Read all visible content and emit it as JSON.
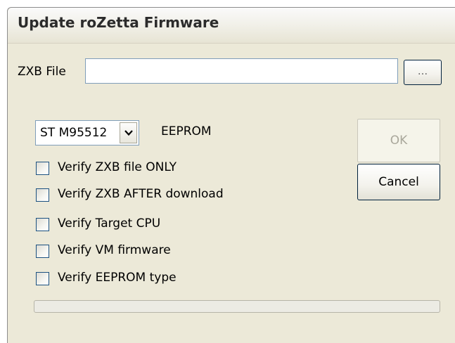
{
  "window": {
    "title": "Update roZetta Firmware"
  },
  "file": {
    "label": "ZXB File",
    "value": "",
    "placeholder": "",
    "browse_label": "..."
  },
  "eeprom": {
    "selected": "ST M95512",
    "label": "EEPROM"
  },
  "buttons": {
    "ok_label": "OK",
    "ok_enabled": false,
    "cancel_label": "Cancel"
  },
  "options": [
    {
      "label": "Verify ZXB file ONLY",
      "checked": false
    },
    {
      "label": "Verify ZXB AFTER download",
      "checked": false
    },
    {
      "label": "Verify Target CPU",
      "checked": false
    },
    {
      "label": "Verify VM firmware",
      "checked": false
    },
    {
      "label": "Verify EEPROM type",
      "checked": false
    }
  ],
  "progress": {
    "fraction": 0
  },
  "icons": {
    "dropdown": "chevron-down-icon"
  },
  "colors": {
    "dialog_bg": "#ece9d8",
    "input_border": "#7f9db9",
    "checkbox_border": "#1c5180",
    "progress_fill": "#2fb24a"
  }
}
